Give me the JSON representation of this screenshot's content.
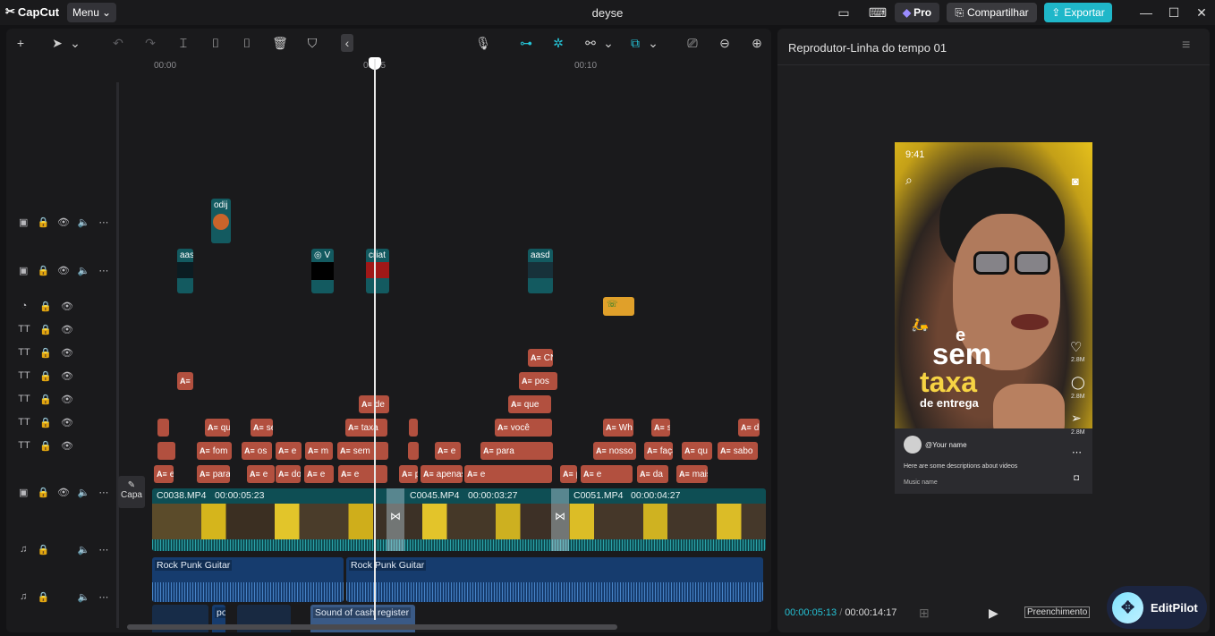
{
  "app": {
    "logo": "CapCut",
    "menu": "Menu",
    "title": "deyse",
    "pro": "Pro",
    "share": "Compartilhar",
    "export": "Exportar"
  },
  "ruler": [
    "00:00",
    "00:05",
    "00:10"
  ],
  "player": {
    "title": "Reprodutor-Linha do tempo 01",
    "current": "00:00:05:13",
    "total": "00:00:14:17",
    "fit": "Preenchimento"
  },
  "phone": {
    "time": "9:41",
    "line1": "e",
    "line2": "sem",
    "line3": "taxa",
    "line4": "de entrega",
    "user": "@Your name",
    "desc": "Here are some descriptions about videos",
    "music": "Music name",
    "likes": "2.8M",
    "comments": "2.8M",
    "shares": "2.8M"
  },
  "editpilot": "EditPilot",
  "cover": "Capa",
  "tracks": {
    "overlay1": [
      {
        "l": "odij"
      }
    ],
    "overlay2": [
      {
        "l": "aas"
      },
      {
        "l": "V"
      },
      {
        "l": "criat"
      },
      {
        "l": "aasd"
      }
    ],
    "text1": [
      "CN"
    ],
    "text2": [
      "e",
      "pos"
    ],
    "text3": [
      "de",
      "que"
    ],
    "text4": [
      "que",
      "se",
      "taxa",
      "você",
      "Wh",
      "se",
      "d"
    ],
    "text5": [
      "fom",
      "os",
      "e",
      "m",
      "sem",
      "e",
      "para",
      "nosso",
      "faça",
      "qu",
      "sabo"
    ],
    "text6": [
      "e",
      "para",
      "e",
      "do",
      "e",
      "e",
      "prom",
      "apenas",
      "e",
      "pelo",
      "e",
      "da",
      "mais"
    ],
    "main": [
      {
        "name": "C0038.MP4",
        "dur": "00:00:05:23"
      },
      {
        "name": "C0045.MP4",
        "dur": "00:00:03:27"
      },
      {
        "name": "C0051.MP4",
        "dur": "00:00:04:27"
      }
    ],
    "audio1": [
      "Rock Punk Guitar",
      "Rock Punk Guitar"
    ],
    "audio2": [
      "po",
      "Sound of cash register"
    ]
  }
}
